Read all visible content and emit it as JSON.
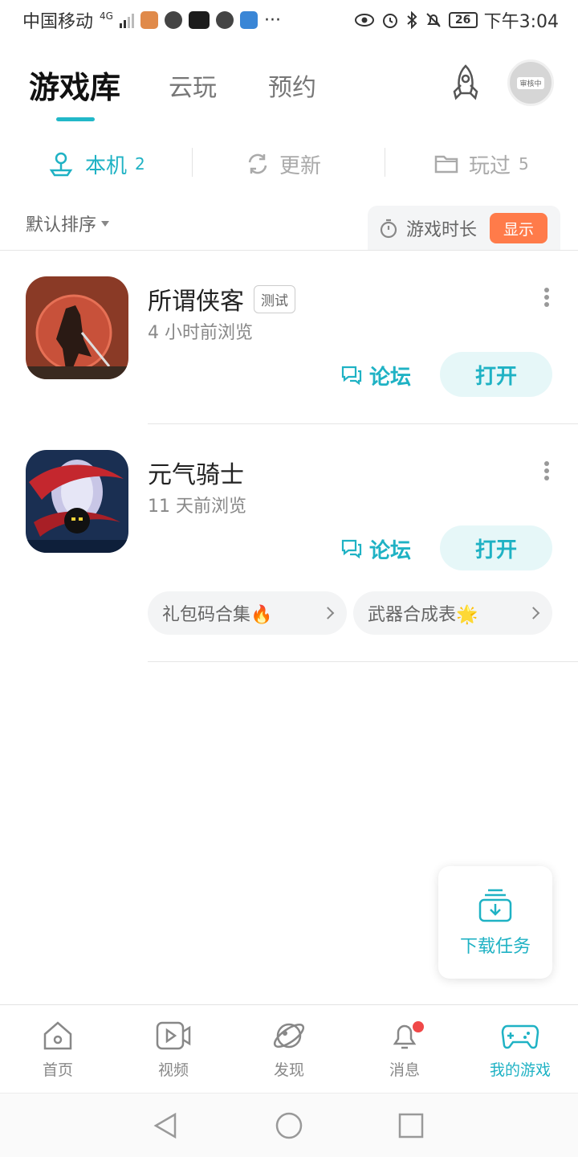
{
  "status_bar": {
    "carrier": "中国移动",
    "network": "4G",
    "battery": "26",
    "time": "下午3:04"
  },
  "header": {
    "tabs": [
      {
        "label": "游戏库",
        "active": true
      },
      {
        "label": "云玩",
        "active": false
      },
      {
        "label": "预约",
        "active": false
      }
    ],
    "avatar_badge": "审核中"
  },
  "subtabs": [
    {
      "label": "本机",
      "count": "2",
      "icon": "local-device-icon",
      "active": true
    },
    {
      "label": "更新",
      "count": "",
      "icon": "refresh-icon",
      "active": false
    },
    {
      "label": "玩过",
      "count": "5",
      "icon": "folder-icon",
      "active": false
    }
  ],
  "filter": {
    "sort_label": "默认排序",
    "playtime_label": "游戏时长",
    "show_label": "显示"
  },
  "games": [
    {
      "title": "所谓侠客",
      "tag": "测试",
      "subtitle": "4 小时前浏览",
      "forum_label": "论坛",
      "open_label": "打开"
    },
    {
      "title": "元气骑士",
      "tag": "",
      "subtitle": "11 天前浏览",
      "forum_label": "论坛",
      "open_label": "打开",
      "chips": [
        "礼包码合集🔥",
        "武器合成表🌟"
      ]
    }
  ],
  "download": {
    "label": "下载任务"
  },
  "bottom_nav": [
    {
      "label": "首页",
      "icon": "home-icon",
      "active": false
    },
    {
      "label": "视频",
      "icon": "video-icon",
      "active": false
    },
    {
      "label": "发现",
      "icon": "planet-icon",
      "active": false
    },
    {
      "label": "消息",
      "icon": "bell-icon",
      "active": false,
      "badge": true
    },
    {
      "label": "我的游戏",
      "icon": "gamepad-icon",
      "active": true
    }
  ],
  "colors": {
    "accent": "#1fb2c4",
    "show_button": "#ff7b4a",
    "badge": "#f04848"
  }
}
